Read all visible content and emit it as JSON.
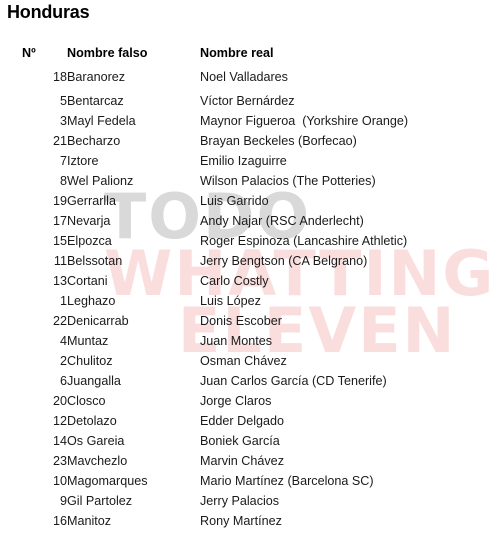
{
  "document": {
    "title": "Honduras"
  },
  "watermark": {
    "lines": [
      {
        "text": "TODO",
        "color": "#d9d9d9"
      },
      {
        "text": "WHATTING",
        "color": "#fadedd"
      },
      {
        "text": "ELEVEN",
        "color": "#fadedd"
      }
    ]
  },
  "table": {
    "headers": {
      "number": "Nº",
      "fake_name": "Nombre falso",
      "real_name": "Nombre real"
    },
    "rows": [
      {
        "number": "18",
        "fake_name": "Baranorez",
        "real_name": "Noel Valladares"
      },
      {
        "number": "5",
        "fake_name": "Bentarcaz",
        "real_name": "Víctor Bernárdez"
      },
      {
        "number": "3",
        "fake_name": "Mayl Fedela",
        "real_name": "Maynor Figueroa  (Yorkshire Orange)"
      },
      {
        "number": "21",
        "fake_name": "Becharzo",
        "real_name": "Brayan Beckeles (Borfecao)"
      },
      {
        "number": "7",
        "fake_name": "Iztore",
        "real_name": "Emilio Izaguirre"
      },
      {
        "number": "8",
        "fake_name": "Wel Palionz",
        "real_name": "Wilson Palacios (The Potteries)"
      },
      {
        "number": "19",
        "fake_name": "Gerrarlla",
        "real_name": "Luis Garrido"
      },
      {
        "number": "17",
        "fake_name": "Nevarja",
        "real_name": "Andy Najar (RSC Anderlecht)"
      },
      {
        "number": "15",
        "fake_name": "Elpozca",
        "real_name": "Roger Espinoza (Lancashire Athletic)"
      },
      {
        "number": "11",
        "fake_name": "Belssotan",
        "real_name": "Jerry Bengtson (CA Belgrano)"
      },
      {
        "number": "13",
        "fake_name": "Cortani",
        "real_name": "Carlo Costly"
      },
      {
        "number": "1",
        "fake_name": "Leghazo",
        "real_name": "Luis López"
      },
      {
        "number": "22",
        "fake_name": "Denicarrab",
        "real_name": "Donis Escober"
      },
      {
        "number": "4",
        "fake_name": "Muntaz",
        "real_name": "Juan Montes"
      },
      {
        "number": "2",
        "fake_name": "Chulitoz",
        "real_name": "Osman Chávez"
      },
      {
        "number": "6",
        "fake_name": "Juangalla",
        "real_name": "Juan Carlos García (CD Tenerife)"
      },
      {
        "number": "20",
        "fake_name": "Closco",
        "real_name": "Jorge Claros"
      },
      {
        "number": "12",
        "fake_name": "Detolazo",
        "real_name": "Edder Delgado"
      },
      {
        "number": "14",
        "fake_name": "Os Gareia",
        "real_name": "Boniek García"
      },
      {
        "number": "23",
        "fake_name": "Mavchezlo",
        "real_name": "Marvin Chávez"
      },
      {
        "number": "10",
        "fake_name": "Magomarques",
        "real_name": "Mario Martínez (Barcelona SC)"
      },
      {
        "number": "9",
        "fake_name": "Gil Partolez",
        "real_name": "Jerry Palacios"
      },
      {
        "number": "16",
        "fake_name": "Manitoz",
        "real_name": "Rony Martínez"
      }
    ]
  }
}
